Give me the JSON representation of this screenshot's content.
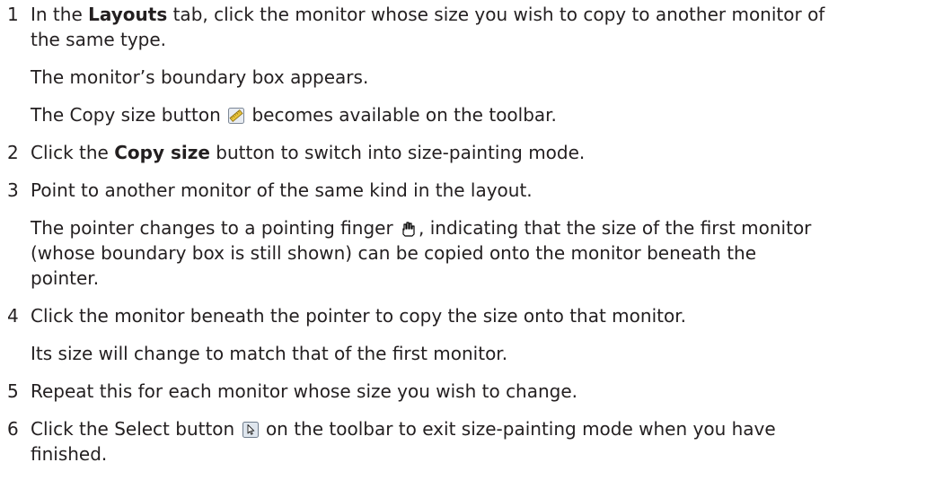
{
  "steps": [
    {
      "num": "1",
      "line1_pre": "In the ",
      "line1_bold": "Layouts",
      "line1_post": " tab, click the monitor whose size you wish to copy to another monitor of",
      "line2": "the same type.",
      "result1": "The monitor’s boundary box appears.",
      "result2_pre": "The Copy size button",
      "result2_post": "becomes available on the toolbar.",
      "icon": "ruler-icon"
    },
    {
      "num": "2",
      "pre": "Click the ",
      "bold": "Copy size",
      "post": " button to switch into size-painting mode."
    },
    {
      "num": "3",
      "text": "Point to another monitor of the same kind in the layout.",
      "result1_pre": "The pointer changes to a pointing finger",
      "result1_post": ", indicating that the size of the first monitor",
      "result2": "(whose boundary box is still shown) can be copied onto the monitor beneath the",
      "result3": "pointer.",
      "icon": "pointing-finger-icon"
    },
    {
      "num": "4",
      "text": "Click the monitor beneath the pointer to copy the size onto that monitor.",
      "result": "Its size will change to match that of the first monitor."
    },
    {
      "num": "5",
      "text": "Repeat this for each monitor whose size you wish to change."
    },
    {
      "num": "6",
      "pre": "Click the Select button",
      "post": "on the toolbar to exit size-painting mode when you have",
      "line2": "finished.",
      "icon": "select-arrow-icon"
    }
  ],
  "colors": {
    "text": "#231f20",
    "background": "#ffffff"
  }
}
